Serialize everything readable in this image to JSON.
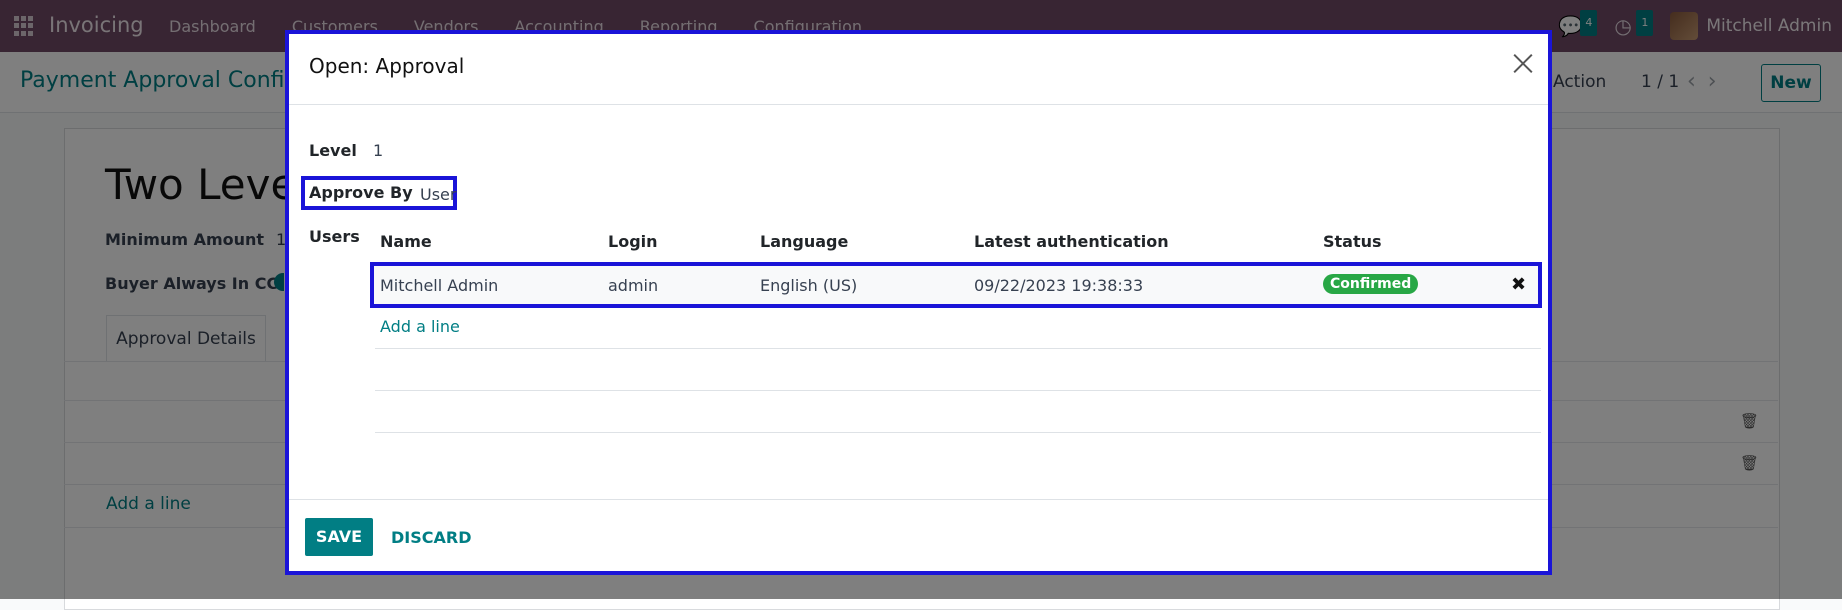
{
  "navbar": {
    "app_name": "Invoicing",
    "menu": [
      "Dashboard",
      "Customers",
      "Vendors",
      "Accounting",
      "Reporting",
      "Configuration"
    ],
    "messages_count": "4",
    "activities_count": "1",
    "user_name": "Mitchell Admin"
  },
  "control_panel": {
    "breadcrumb": "Payment Approval Config",
    "action_label": "Action",
    "pager": "1 / 1",
    "new_label": "New"
  },
  "background_form": {
    "title": "Two Level",
    "minimum_amount_label": "Minimum Amount",
    "minimum_amount_value": "1",
    "buyer_cc_label": "Buyer Always In CC",
    "tab_label": "Approval Details",
    "add_line_label": "Add a line"
  },
  "modal": {
    "title": "Open: Approval",
    "level_label": "Level",
    "level_value": "1",
    "approve_by_label": "Approve By",
    "approve_by_value": "User",
    "users_label": "Users",
    "table": {
      "headers": [
        "Name",
        "Login",
        "Language",
        "Latest authentication",
        "Status"
      ],
      "rows": [
        {
          "name": "Mitchell Admin",
          "login": "admin",
          "language": "English (US)",
          "latest_authentication": "09/22/2023 19:38:33",
          "status": "Confirmed"
        }
      ]
    },
    "add_line_label": "Add a line",
    "save_label": "SAVE",
    "discard_label": "DISCARD"
  },
  "colors": {
    "brand": "#714b67",
    "accent": "#017e84",
    "highlight_border": "#1a14d8",
    "status_confirmed": "#28a745"
  }
}
